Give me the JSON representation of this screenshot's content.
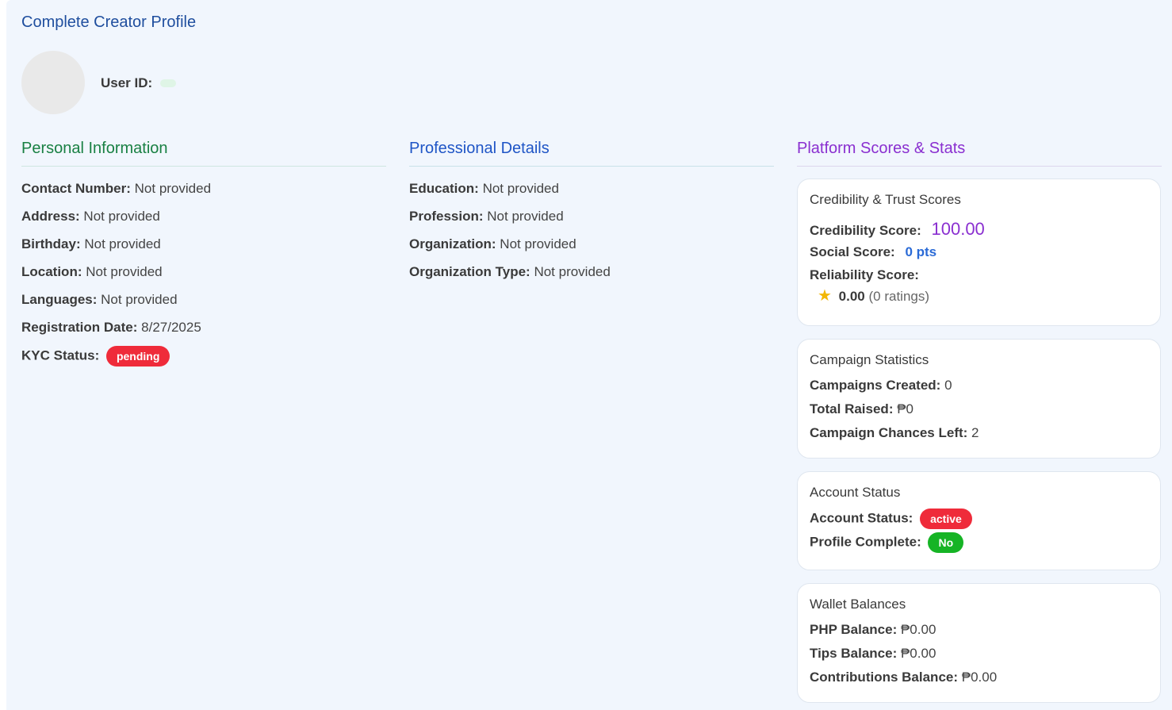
{
  "page": {
    "title": "Complete Creator Profile"
  },
  "user": {
    "id_label": "User ID:"
  },
  "personal": {
    "heading": "Personal Information",
    "rows": [
      {
        "label": "Contact Number:",
        "value": "Not provided"
      },
      {
        "label": "Address:",
        "value": "Not provided"
      },
      {
        "label": "Birthday:",
        "value": "Not provided"
      },
      {
        "label": "Location:",
        "value": "Not provided"
      },
      {
        "label": "Languages:",
        "value": "Not provided"
      },
      {
        "label": "Registration Date:",
        "value": "8/27/2025"
      }
    ],
    "kyc": {
      "label": "KYC Status:",
      "value": "pending"
    }
  },
  "professional": {
    "heading": "Professional Details",
    "rows": [
      {
        "label": "Education:",
        "value": "Not provided"
      },
      {
        "label": "Profession:",
        "value": "Not provided"
      },
      {
        "label": "Organization:",
        "value": "Not provided"
      },
      {
        "label": "Organization Type:",
        "value": "Not provided"
      }
    ]
  },
  "platform": {
    "heading": "Platform Scores & Stats",
    "credibility_card": {
      "title": "Credibility & Trust Scores",
      "credibility_label": "Credibility Score:",
      "credibility_value": "100.00",
      "social_label": "Social Score:",
      "social_value": "0 pts",
      "reliability_label": "Reliability Score:",
      "reliability_value": "0.00",
      "reliability_count": "(0 ratings)",
      "star_icon": "star-icon"
    },
    "campaign_card": {
      "title": "Campaign Statistics",
      "created_label": "Campaigns Created:",
      "created_value": "0",
      "raised_label": "Total Raised:",
      "raised_value": "₱0",
      "chances_label": "Campaign Chances Left:",
      "chances_value": "2"
    },
    "account_card": {
      "title": "Account Status",
      "status_label": "Account Status:",
      "status_value": "active",
      "complete_label": "Profile Complete:",
      "complete_value": "No"
    },
    "wallet_card": {
      "title": "Wallet Balances",
      "php_label": "PHP Balance:",
      "php_value": "₱0.00",
      "tips_label": "Tips Balance:",
      "tips_value": "₱0.00",
      "contrib_label": "Contributions Balance:",
      "contrib_value": "₱0.00"
    }
  },
  "colors": {
    "panel_bg": "#f1f6fd",
    "personal_accent": "#198043",
    "professional_accent": "#1f55c6",
    "platform_accent": "#8a2fd0",
    "badge_red": "#ef2b3a",
    "badge_green": "#16b425"
  }
}
